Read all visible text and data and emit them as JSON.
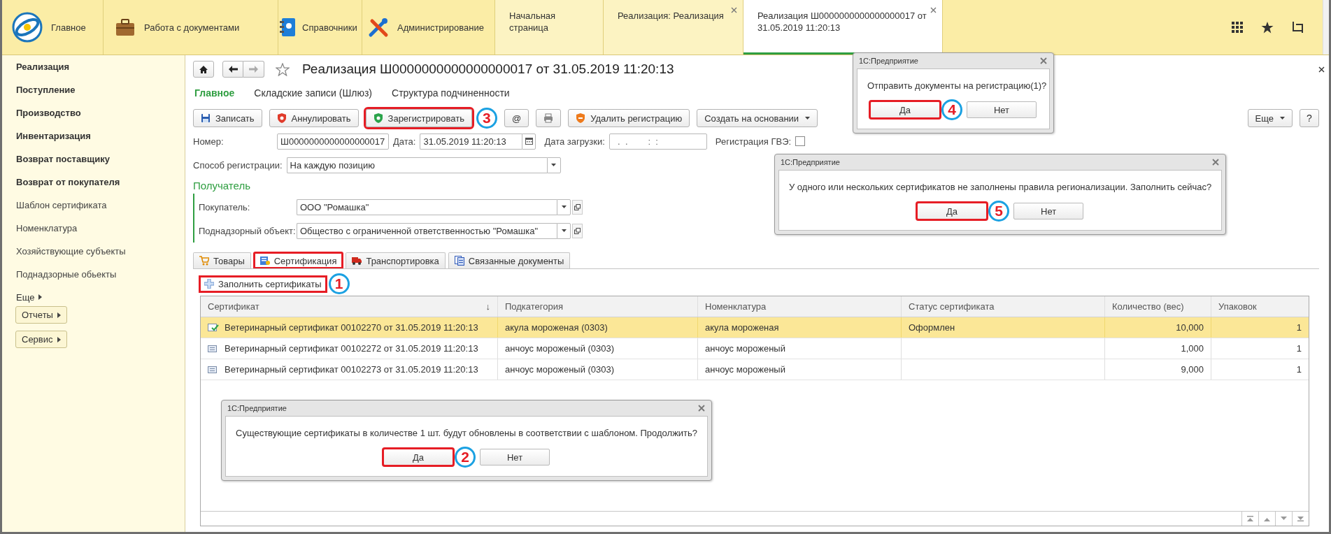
{
  "top_bar": {
    "sections": [
      {
        "kind": "home",
        "label": "Главное"
      },
      {
        "kind": "documents",
        "label": "Работа с документами"
      },
      {
        "kind": "catalogs",
        "label": "Справочники"
      },
      {
        "kind": "admin",
        "label": "Администрирование"
      }
    ],
    "open_tabs": [
      {
        "label": "Начальная страница",
        "selected": false,
        "closable": false
      },
      {
        "label": "Реализация: Реализация",
        "selected": false,
        "closable": true
      },
      {
        "label": "Реализация Ш0000000000000000017 от 31.05.2019 11:20:13",
        "selected": true,
        "closable": true
      }
    ]
  },
  "sidebar": {
    "items": [
      {
        "label": "Реализация",
        "bold": true
      },
      {
        "label": "Поступление",
        "bold": true
      },
      {
        "label": "Производство",
        "bold": true
      },
      {
        "label": "Инвентаризация",
        "bold": true
      },
      {
        "label": "Возврат поставщику",
        "bold": true
      },
      {
        "label": "Возврат от покупателя",
        "bold": true
      },
      {
        "label": "Шаблон сертификата",
        "bold": false
      },
      {
        "label": "Номенклатура",
        "bold": false
      },
      {
        "label": "Хозяйствующие субъекты",
        "bold": false
      },
      {
        "label": "Поднадзорные обьекты",
        "bold": false
      }
    ],
    "more": "Еще",
    "buttons": [
      "Отчеты",
      "Сервис"
    ]
  },
  "form": {
    "title": "Реализация Ш0000000000000000017 от 31.05.2019 11:20:13",
    "sections": [
      {
        "label": "Главное",
        "selected": true
      },
      {
        "label": "Складские записи (Шлюз)",
        "selected": false
      },
      {
        "label": "Структура подчиненности",
        "selected": false
      }
    ],
    "toolbar": [
      {
        "kind": "save",
        "label": "Записать",
        "highlighted": false,
        "dropdown": false
      },
      {
        "kind": "cancel",
        "label": "Аннулировать",
        "highlighted": false,
        "dropdown": false
      },
      {
        "kind": "register",
        "label": "Зарегистрировать",
        "highlighted": true,
        "step": "3",
        "dropdown": false
      },
      {
        "kind": "text",
        "label": "@",
        "highlighted": false,
        "dropdown": false
      },
      {
        "kind": "print",
        "highlighted": false,
        "dropdown": false
      },
      {
        "kind": "unregister",
        "label": "Удалить регистрацию",
        "highlighted": false,
        "dropdown": false
      },
      {
        "kind": "text",
        "label": "Создать на основании",
        "highlighted": false,
        "dropdown": true
      }
    ],
    "more_button": "Еще",
    "help_button": "?",
    "number": {
      "label": "Номер:",
      "value": "Ш0000000000000000017"
    },
    "date": {
      "label": "Дата:",
      "value": "31.05.2019 11:20:13"
    },
    "load_date": {
      "label": "Дата загрузки:",
      "value": "  .  .        :  :"
    },
    "gve": {
      "label": "Регистрация ГВЭ:",
      "checked": false
    },
    "method": {
      "label": "Способ регистрации:",
      "value": "На каждую позицию"
    },
    "recipient": {
      "title": "Получатель",
      "buyer": {
        "label": "Покупатель:",
        "value": "ООО \"Ромашка\""
      },
      "object": {
        "label": "Поднадзорный объект:",
        "value": "Общество с ограниченной ответственностью \"Ромашка\""
      }
    },
    "tabs": [
      {
        "kind": "goods",
        "label": "Товары",
        "selected": false,
        "highlighted": false
      },
      {
        "kind": "certification",
        "label": "Сертификация",
        "selected": true,
        "highlighted": true
      },
      {
        "kind": "transport",
        "label": "Транспортировка",
        "selected": false,
        "highlighted": false
      },
      {
        "kind": "documents",
        "label": "Связанные документы",
        "selected": false,
        "highlighted": false
      }
    ],
    "fill_button": {
      "label": "Заполнить сертификаты",
      "highlighted": true,
      "step": "1"
    },
    "table": {
      "columns": [
        {
          "label": "Сертификат",
          "sort": "↓"
        },
        {
          "label": "Подкатегория"
        },
        {
          "label": "Номенклатура"
        },
        {
          "label": "Статус сертификата"
        },
        {
          "label": "Количество (вес)"
        },
        {
          "label": "Упаковок"
        }
      ],
      "rows": [
        {
          "selected": true,
          "confirmed": true,
          "cells": [
            "Ветеринарный сертификат 00102270 от 31.05.2019 11:20:13",
            "акула мороженая (0303)",
            "акула мороженая",
            "Оформлен",
            "10,000",
            "1"
          ]
        },
        {
          "selected": false,
          "confirmed": false,
          "cells": [
            "Ветеринарный сертификат 00102272 от 31.05.2019 11:20:13",
            "анчоус мороженый (0303)",
            "анчоус мороженый",
            "",
            "1,000",
            "1"
          ]
        },
        {
          "selected": false,
          "confirmed": false,
          "cells": [
            "Ветеринарный сертификат 00102273 от 31.05.2019 11:20:13",
            "анчоус мороженый (0303)",
            "анчоус мороженый",
            "",
            "9,000",
            "1"
          ]
        }
      ]
    }
  },
  "dialogs": [
    {
      "title": "1С:Предприятие",
      "message": "Отправить документы на регистрацию(1)?",
      "buttons": [
        {
          "label": "Да",
          "highlighted": true,
          "step": "4"
        },
        {
          "label": "Нет",
          "highlighted": false
        }
      ]
    },
    {
      "title": "1С:Предприятие",
      "message": "У одного или нескольких сертификатов не заполнены правила регионализации. Заполнить сейчас?",
      "buttons": [
        {
          "label": "Да",
          "highlighted": true,
          "step": "5"
        },
        {
          "label": "Нет",
          "highlighted": false
        }
      ]
    },
    {
      "title": "1С:Предприятие",
      "message": "Существующие сертификаты в количестве 1 шт. будут обновлены в соответствии с шаблоном. Продолжить?",
      "buttons": [
        {
          "label": "Да",
          "highlighted": true,
          "step": "2"
        },
        {
          "label": "Нет",
          "highlighted": false
        }
      ]
    }
  ]
}
